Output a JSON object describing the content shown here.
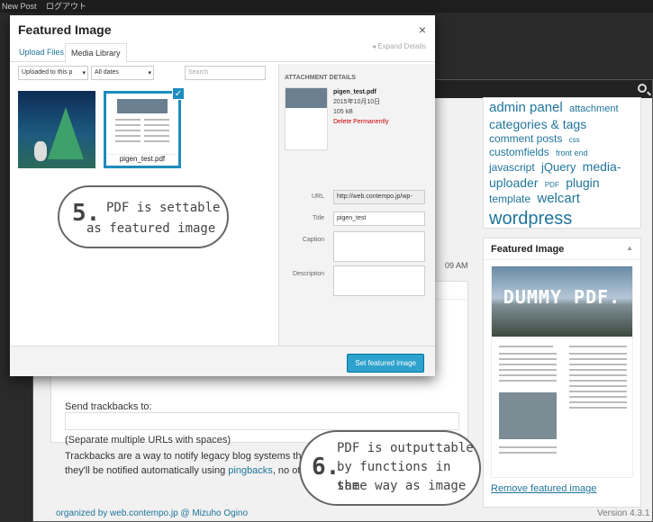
{
  "topbar": {
    "left": "New Post",
    "right": "ログアウト"
  },
  "tags": [
    "admin panel",
    "attachment",
    "categories & tags",
    "comment posts",
    "css",
    "customfields",
    "front end",
    "javascript",
    "jQuery",
    "media-uploader",
    "PDF",
    "plugin",
    "template",
    "welcart",
    "wordpress"
  ],
  "featured_box": {
    "title": "Featured Image",
    "remove_link": "Remove featured image",
    "pdf_hero": "DUMMY PDF."
  },
  "trackbacks": {
    "label": "Send trackbacks to:",
    "note": "(Separate multiple URLs with spaces)",
    "line1": "Trackbacks are a way to notify legacy blog systems that you've linked",
    "line2_pre": "they'll be notified automatically using ",
    "line2_link": "pingbacks",
    "line2_post": ", no other action nec"
  },
  "time_fragment": "09 AM",
  "footer": {
    "left": "organized by web.contempo.jp @ Mizuho Ogino",
    "right": "Version 4.3.1"
  },
  "modal": {
    "title": "Featured Image",
    "close": "×",
    "tabs": [
      "Upload Files",
      "Media Library"
    ],
    "expand": "Expand Details",
    "filter_upload": "Uploaded to this p",
    "filter_dates": "All dates",
    "search_placeholder": "Search",
    "thumb2_caption": "pigen_test.pdf",
    "details": {
      "heading": "ATTACHMENT DETAILS",
      "filename": "pigen_test.pdf",
      "date": "2015年10月10日",
      "size": "105 kB",
      "delete": "Delete Permanently",
      "url_label": "URL",
      "url_value": "http://web.contempo.jp/wp-",
      "title_label": "Title",
      "title_value": "pigen_test",
      "caption_label": "Caption",
      "description_label": "Description"
    },
    "set_button": "Set featured image"
  },
  "callout5": {
    "num": "5.",
    "line1": "PDF is settable",
    "line2": "as featured image"
  },
  "callout6": {
    "num": "6.",
    "line1": "PDF is outputtable",
    "line2": "by functions in the",
    "line3": "same way as image"
  }
}
